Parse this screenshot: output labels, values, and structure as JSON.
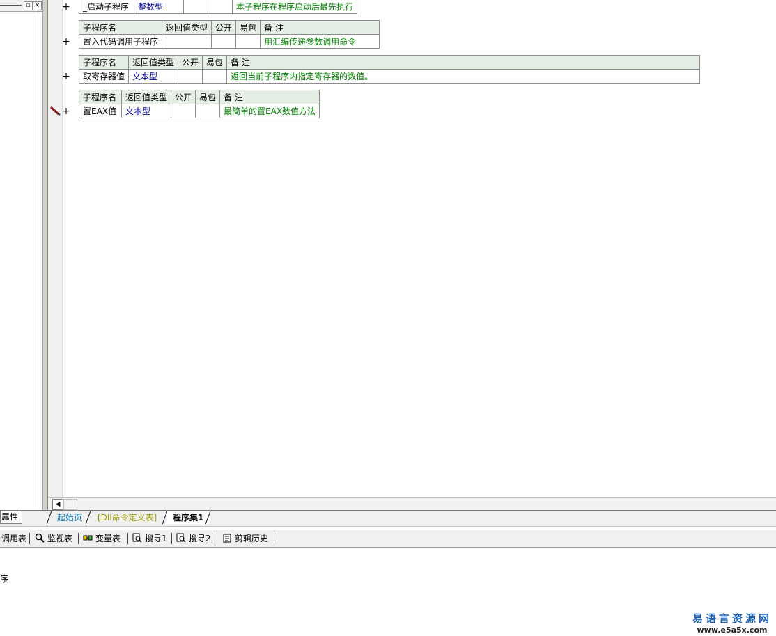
{
  "left_panel": {
    "min_icon": "minimize-icon",
    "close_icon": "close-icon"
  },
  "procedures": [
    {
      "name": "_启动子程序",
      "return_type": "整数型",
      "public": "",
      "package": "",
      "note": "本子程序在程序启动后最先执行"
    },
    {
      "headers": [
        "子程序名",
        "返回值类型",
        "公开",
        "易包",
        "备 注"
      ],
      "name": "置入代码调用子程序",
      "return_type": "",
      "public": "",
      "package": "",
      "note": "用汇编传递参数调用命令"
    },
    {
      "headers": [
        "子程序名",
        "返回值类型",
        "公开",
        "易包",
        "备 注"
      ],
      "name": "取寄存器值",
      "return_type": "文本型",
      "public": "",
      "package": "",
      "note": "返回当前子程序内指定寄存器的数值。"
    },
    {
      "headers": [
        "子程序名",
        "返回值类型",
        "公开",
        "易包",
        "备 注"
      ],
      "name": "置EAX值",
      "return_type": "文本型",
      "public": "",
      "package": "",
      "note": "最简单的置EAX数值方法"
    }
  ],
  "plus_label": "+",
  "tabs": {
    "properties": "属性",
    "start_page": "起始页",
    "dll_defs": "[Dll命令定义表]",
    "program_set": "程序集1"
  },
  "toolbar": [
    {
      "icon": "call-table-icon",
      "label": "调用表"
    },
    {
      "icon": "magnifier-icon",
      "label": "监视表"
    },
    {
      "icon": "variable-icon",
      "label": "变量表"
    },
    {
      "icon": "search1-icon",
      "label": "搜寻1"
    },
    {
      "icon": "search2-icon",
      "label": "搜寻2"
    },
    {
      "icon": "clipboard-icon",
      "label": "剪辑历史"
    }
  ],
  "status": {
    "text": "序"
  },
  "watermark": {
    "cn": "易语言资源网",
    "url": "www.e5a5x.com"
  }
}
